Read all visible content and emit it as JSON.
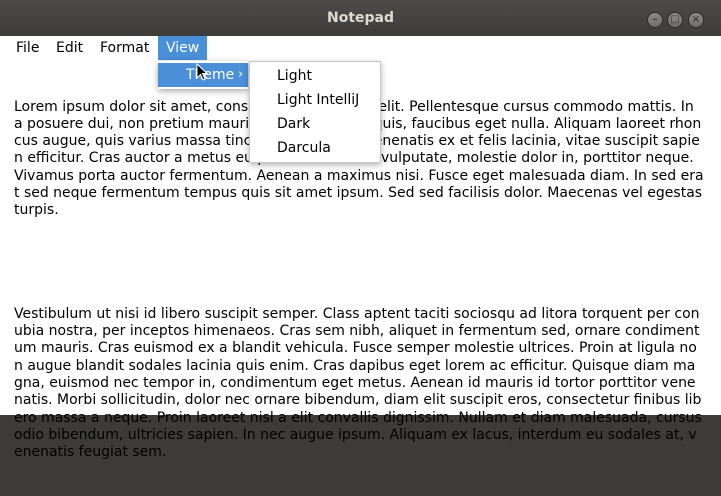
{
  "window": {
    "title": "Notepad"
  },
  "window_controls": {
    "minimize_icon": "minimize-icon",
    "maximize_icon": "maximize-icon",
    "close_icon": "close-icon"
  },
  "menubar": {
    "file": "File",
    "edit": "Edit",
    "format": "Format",
    "view": "View"
  },
  "view_menu": {
    "theme": "Theme",
    "arrow": "›"
  },
  "theme_submenu": [
    "Light",
    "Light IntelliJ",
    "Dark",
    "Darcula"
  ],
  "document": {
    "paragraph1": "Lorem ipsum dolor sit amet, consectetur adipiscing elit. Pellentesque cursus commodo mattis. In a posuere dui, non pretium mauris. Morbi pharetra quis, faucibus eget nulla. Aliquam laoreet rhoncus augue, quis varius massa tincidunt quis. Cras venenatis ex et felis lacinia, vitae suscipit sapien efficitur. Cras auctor a metus eu pulvinar. Ut nunc vulputate, molestie dolor in, porttitor neque. Vivamus porta auctor fermentum. Aenean a maximus nisi. Fusce eget malesuada diam. In sed erat sed neque fermentum tempus quis sit amet ipsum. Sed sed facilisis dolor. Maecenas vel egestas turpis.",
    "paragraph2": "Vestibulum ut nisi id libero suscipit semper. Class aptent taciti sociosqu ad litora torquent per conubia nostra, per inceptos himenaeos. Cras sem nibh, aliquet in fermentum sed, ornare condimentum mauris. Cras euismod ex a blandit vehicula. Fusce semper molestie ultrices. Proin at ligula non augue blandit sodales lacinia quis enim. Cras dapibus eget lorem ac efficitur. Quisque diam magna, euismod nec tempor in, condimentum eget metus. Aenean id mauris id tortor porttitor venenatis. Morbi sollicitudin, dolor nec ornare bibendum, diam elit suscipit eros, consectetur finibus libero massa a neque. Proin laoreet nisl a elit convallis dignissim. Nullam et diam malesuada, cursus odio bibendum, ultricies sapien. In nec augue ipsum. Aliquam ex lacus, interdum eu sodales at, venenatis feugiat sem."
  },
  "colors": {
    "titlebar": "#3c3b37",
    "menu_highlight": "#4a90d9",
    "title_text": "#dfdbd2"
  }
}
